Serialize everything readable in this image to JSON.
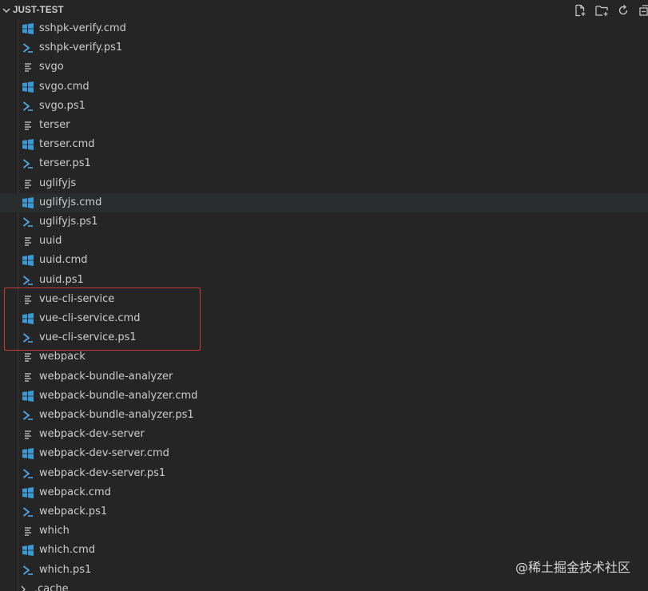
{
  "explorer": {
    "title": "JUST-TEST",
    "actions": [
      {
        "name": "new-file-icon"
      },
      {
        "name": "new-folder-icon"
      },
      {
        "name": "refresh-icon"
      },
      {
        "name": "collapse-all-icon"
      }
    ]
  },
  "files": [
    {
      "label": "sshpk-verify.cmd",
      "type": "cmd"
    },
    {
      "label": "sshpk-verify.ps1",
      "type": "ps1"
    },
    {
      "label": "svgo",
      "type": "plain"
    },
    {
      "label": "svgo.cmd",
      "type": "cmd"
    },
    {
      "label": "svgo.ps1",
      "type": "ps1"
    },
    {
      "label": "terser",
      "type": "plain"
    },
    {
      "label": "terser.cmd",
      "type": "cmd"
    },
    {
      "label": "terser.ps1",
      "type": "ps1"
    },
    {
      "label": "uglifyjs",
      "type": "plain"
    },
    {
      "label": "uglifyjs.cmd",
      "type": "cmd",
      "hovered": true
    },
    {
      "label": "uglifyjs.ps1",
      "type": "ps1"
    },
    {
      "label": "uuid",
      "type": "plain"
    },
    {
      "label": "uuid.cmd",
      "type": "cmd"
    },
    {
      "label": "uuid.ps1",
      "type": "ps1"
    },
    {
      "label": "vue-cli-service",
      "type": "plain"
    },
    {
      "label": "vue-cli-service.cmd",
      "type": "cmd"
    },
    {
      "label": "vue-cli-service.ps1",
      "type": "ps1"
    },
    {
      "label": "webpack",
      "type": "plain"
    },
    {
      "label": "webpack-bundle-analyzer",
      "type": "plain"
    },
    {
      "label": "webpack-bundle-analyzer.cmd",
      "type": "cmd"
    },
    {
      "label": "webpack-bundle-analyzer.ps1",
      "type": "ps1"
    },
    {
      "label": "webpack-dev-server",
      "type": "plain"
    },
    {
      "label": "webpack-dev-server.cmd",
      "type": "cmd"
    },
    {
      "label": "webpack-dev-server.ps1",
      "type": "ps1"
    },
    {
      "label": "webpack.cmd",
      "type": "cmd"
    },
    {
      "label": "webpack.ps1",
      "type": "ps1"
    },
    {
      "label": "which",
      "type": "plain"
    },
    {
      "label": "which.cmd",
      "type": "cmd"
    },
    {
      "label": "which.ps1",
      "type": "ps1"
    }
  ],
  "folder": {
    "label": ".cache"
  },
  "watermark": "@稀土掘金技术社区",
  "colors": {
    "background": "#252526",
    "text": "#cccccc",
    "windows_icon": "#3b9ad6",
    "powershell_icon": "#4fa6e0",
    "highlight_border": "#c93b3b",
    "hover_row": "#2a2d2e"
  }
}
